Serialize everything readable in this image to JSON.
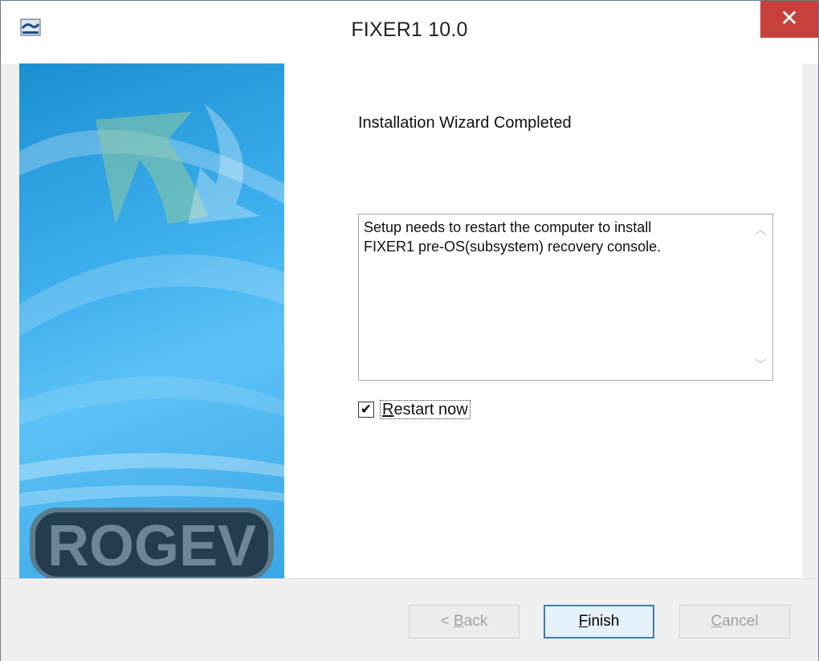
{
  "window": {
    "title": "FIXER1 10.0",
    "close_glyph": "✕"
  },
  "sidebar": {
    "logo_text": "ROGEV",
    "background_color": "#3fb0ee"
  },
  "content": {
    "heading": "Installation Wizard Completed",
    "message": "Setup needs to restart the computer to install\nFIXER1 pre-OS(subsystem) recovery console.",
    "restart_checkbox": {
      "checked": true,
      "label_prefix": "",
      "label_underlined": "R",
      "label_rest": "estart now"
    }
  },
  "footer": {
    "back": {
      "prefix": "< ",
      "underlined": "B",
      "rest": "ack",
      "enabled": false
    },
    "finish": {
      "prefix": "",
      "underlined": "F",
      "rest": "inish",
      "enabled": true
    },
    "cancel": {
      "prefix": "",
      "underlined": "C",
      "rest": "ancel",
      "enabled": false
    }
  },
  "colors": {
    "close_button": "#c7403b",
    "default_button_border": "#3c7fb1"
  }
}
